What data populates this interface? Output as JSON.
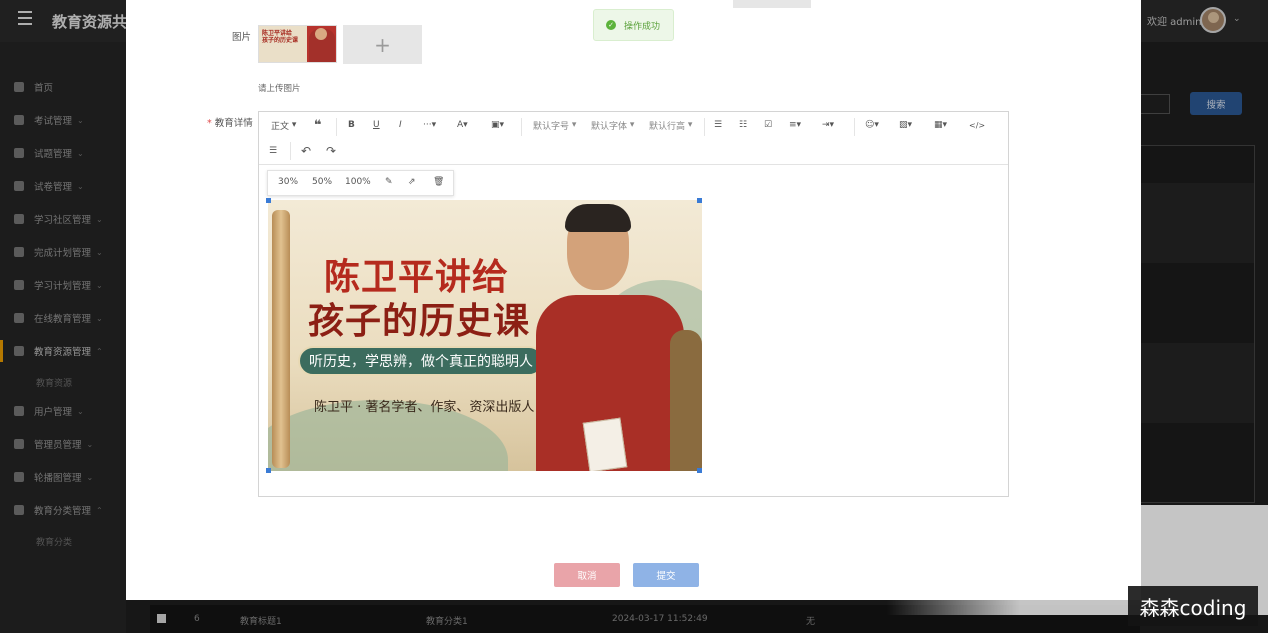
{
  "app": {
    "title": "教育资源共",
    "welcome": "欢迎 admin"
  },
  "sidebar": {
    "items": [
      {
        "label": "首页",
        "icon": "home-icon"
      },
      {
        "label": "考试管理",
        "icon": "exam-icon"
      },
      {
        "label": "试题管理",
        "icon": "question-icon"
      },
      {
        "label": "试卷管理",
        "icon": "paper-icon"
      },
      {
        "label": "学习社区管理",
        "icon": "community-icon"
      },
      {
        "label": "完成计划管理",
        "icon": "plan-done-icon"
      },
      {
        "label": "学习计划管理",
        "icon": "plan-icon"
      },
      {
        "label": "在线教育管理",
        "icon": "online-edu-icon"
      },
      {
        "label": "教育资源管理",
        "icon": "resource-icon"
      },
      {
        "label": "用户管理",
        "icon": "user-icon"
      },
      {
        "label": "管理员管理",
        "icon": "admin-icon"
      },
      {
        "label": "轮播图管理",
        "icon": "carousel-icon"
      },
      {
        "label": "教育分类管理",
        "icon": "category-icon"
      }
    ],
    "sub_resource": "教育资源",
    "sub_category": "教育分类"
  },
  "right": {
    "search_button": "搜索"
  },
  "table_row": {
    "index": "6",
    "title": "教育标题1",
    "category": "教育分类1",
    "time": "2024-03-17 11:52:49",
    "extra": "无"
  },
  "dialog": {
    "image_label": "图片",
    "upload_hint": "请上传图片",
    "detail_label": "教育详情",
    "toast": "操作成功",
    "thumb_text": "陈卫平讲给\n孩子的历史课",
    "toolbar": {
      "paragraph": "正文",
      "font_size": "默认字号",
      "font_family": "默认字体",
      "line_height": "默认行高"
    },
    "image_sizes": [
      "30%",
      "50%",
      "100%"
    ],
    "cancel": "取消",
    "submit": "提交"
  },
  "banner": {
    "title_line1": "陈卫平讲给",
    "title_line2": "孩子的历史课",
    "tagline": "听历史，学思辨，做个真正的聪明人",
    "byline": "陈卫平 · 著名学者、作家、资深出版人"
  },
  "watermark": "森森coding",
  "colors": {
    "primary": "#2d5b98",
    "cancel": "#e9a4a9",
    "submit": "#8fb3e6",
    "success": "#5cb33b",
    "active_accent": "#f0a000"
  }
}
